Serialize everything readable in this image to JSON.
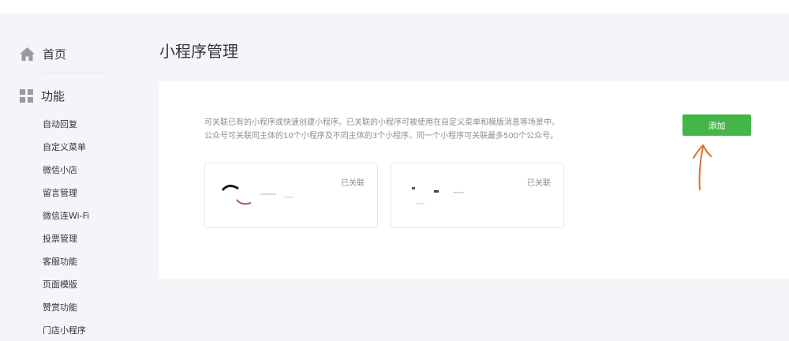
{
  "sidebar": {
    "home_label": "首页",
    "section_label": "功能",
    "items": [
      {
        "label": "自动回复"
      },
      {
        "label": "自定义菜单"
      },
      {
        "label": "微信小店"
      },
      {
        "label": "留言管理"
      },
      {
        "label": "微信连Wi-Fi"
      },
      {
        "label": "投票管理"
      },
      {
        "label": "客服功能"
      },
      {
        "label": "页面模版"
      },
      {
        "label": "赞赏功能"
      },
      {
        "label": "门店小程序"
      }
    ]
  },
  "main": {
    "title": "小程序管理",
    "description_line1": "可关联已有的小程序或快速创建小程序。已关联的小程序可被使用在自定义菜单和模版消息等场景中。",
    "description_line2": "公众号可关联同主体的10个小程序及不同主体的3个小程序。同一个小程序可关联最多500个公众号。",
    "add_label": "添加",
    "cards": [
      {
        "status": "已关联"
      },
      {
        "status": "已关联"
      }
    ]
  },
  "colors": {
    "accent": "#44b549",
    "page_bg": "#f4f5f9",
    "annotation": "#d9702a"
  },
  "icons": {
    "home": "home-icon",
    "function": "grid-icon",
    "annotation": "arrow-up-icon"
  }
}
